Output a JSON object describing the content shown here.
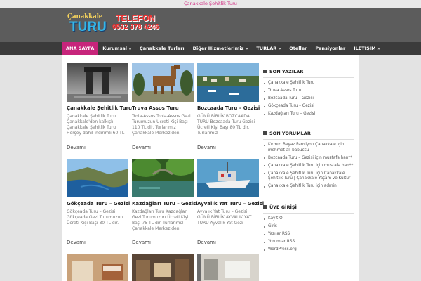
{
  "topbar": {
    "link": "Çanakkale Şehitlik Turu"
  },
  "logo": {
    "line1": "Çanakkale",
    "line2": "TURU"
  },
  "phone": {
    "label": "TELEFON",
    "number": "0532 378 4246"
  },
  "nav": [
    {
      "label": "ANA SAYFA",
      "active": true,
      "has_sub": false
    },
    {
      "label": "Kurumsal",
      "active": false,
      "has_sub": true
    },
    {
      "label": "Çanakkale Turları",
      "active": false,
      "has_sub": false
    },
    {
      "label": "Diğer Hizmetlerimiz",
      "active": false,
      "has_sub": true
    },
    {
      "label": "TURLAR",
      "active": false,
      "has_sub": true
    },
    {
      "label": "Oteller",
      "active": false,
      "has_sub": false
    },
    {
      "label": "Pansiyonlar",
      "active": false,
      "has_sub": false
    },
    {
      "label": "İLETİŞİM",
      "active": false,
      "has_sub": true
    }
  ],
  "posts": [
    {
      "title": "Çanakkale Şehitlik Turu",
      "excerpt": "Çanakkale Şehitlik Turu Çanakkale'den kalkışlı Çanakkale Şehitlik Turu Herşey dahil indirimli 60 TL",
      "more": "Devamı",
      "image": "martyrs-memorial"
    },
    {
      "title": "Truva Assos Turu",
      "excerpt": "Troia-Assos Troia-Assos Gezi Turumuzun Ücreti Kişi Başı 110 TL dir. Turlarımız Çanakkale Merkez'den",
      "more": "Devamı",
      "image": "trojan-horse"
    },
    {
      "title": "Bozcaada Turu – Gezisi",
      "excerpt": "GÜNÜ BİRLİK BOZCAADA TURU Bozcaada Turu Gezisi Ücreti Kişi Başı 80 TL dir. Turlarımız",
      "more": "Devamı",
      "image": "island-harbour"
    },
    {
      "title": "Gökçeada Turu – Gezisi",
      "excerpt": "Gökçeada Turu – Gezisi Gökçeada Gezi Turumuzun Ücreti Kişi Başı 80 TL dir.",
      "more": "Devamı",
      "image": "coastline"
    },
    {
      "title": "Kazdağları Turu – Gezisi",
      "excerpt": "Kazdağları Turu Kazdağları Gezi Turumuzun Ücreti Kişi Başı 75 TL dir. Turlarımız Çanakkale Merkez'den",
      "more": "Devamı",
      "image": "forest-river"
    },
    {
      "title": "Ayvalık Yat Turu – Gezisi",
      "excerpt": "Ayvalık Yat Turu – Gezisi GÜNÜ BİRLİK AYVALIK YAT TURU Ayvalık Yat Gezi",
      "more": "Devamı",
      "image": "yacht"
    },
    {
      "title": "",
      "excerpt": "",
      "more": "",
      "image": "hotel-room"
    },
    {
      "title": "",
      "excerpt": "",
      "more": "",
      "image": "hotel-lobby"
    },
    {
      "title": "",
      "excerpt": "",
      "more": "",
      "image": "hotel-bathroom"
    }
  ],
  "sidebar": {
    "recent_posts": {
      "title": "SON YAZILAR",
      "items": [
        "Çanakkale Şehitlik Turu",
        "Truva Assos Turu",
        "Bozcaada Turu – Gezisi",
        "Gökçeada Turu – Gezisi",
        "Kazdağları Turu – Gezisi"
      ]
    },
    "recent_comments": {
      "title": "SON YORUMLAR",
      "items": [
        "Kırmızı Beyaz Pansiyon Çanakkale için mehmet ali babuccu",
        "Bozcaada Turu – Gezisi için mustafa han**",
        "Çanakkale Şehitlik Turu için mustafa han**",
        "Çanakkale Şehitlik Turu için Çanakkale Şehitlik Turu | Çanakkale Yaşam ve Kültür",
        "Çanakkale Şehitlik Turu için admin"
      ]
    },
    "meta": {
      "title": "ÜYE GİRİŞİ",
      "items": [
        "Kayıt Ol",
        "Giriş",
        "Yazılar RSS",
        "Yorumlar RSS",
        "WordPress.org"
      ]
    }
  },
  "colors": {
    "accent": "#c7257b",
    "nav_bg": "#3b3b3b",
    "header_bg": "#5c5c5c",
    "logo_blue": "#35b6e8",
    "phone_red": "#ef2b2b"
  }
}
